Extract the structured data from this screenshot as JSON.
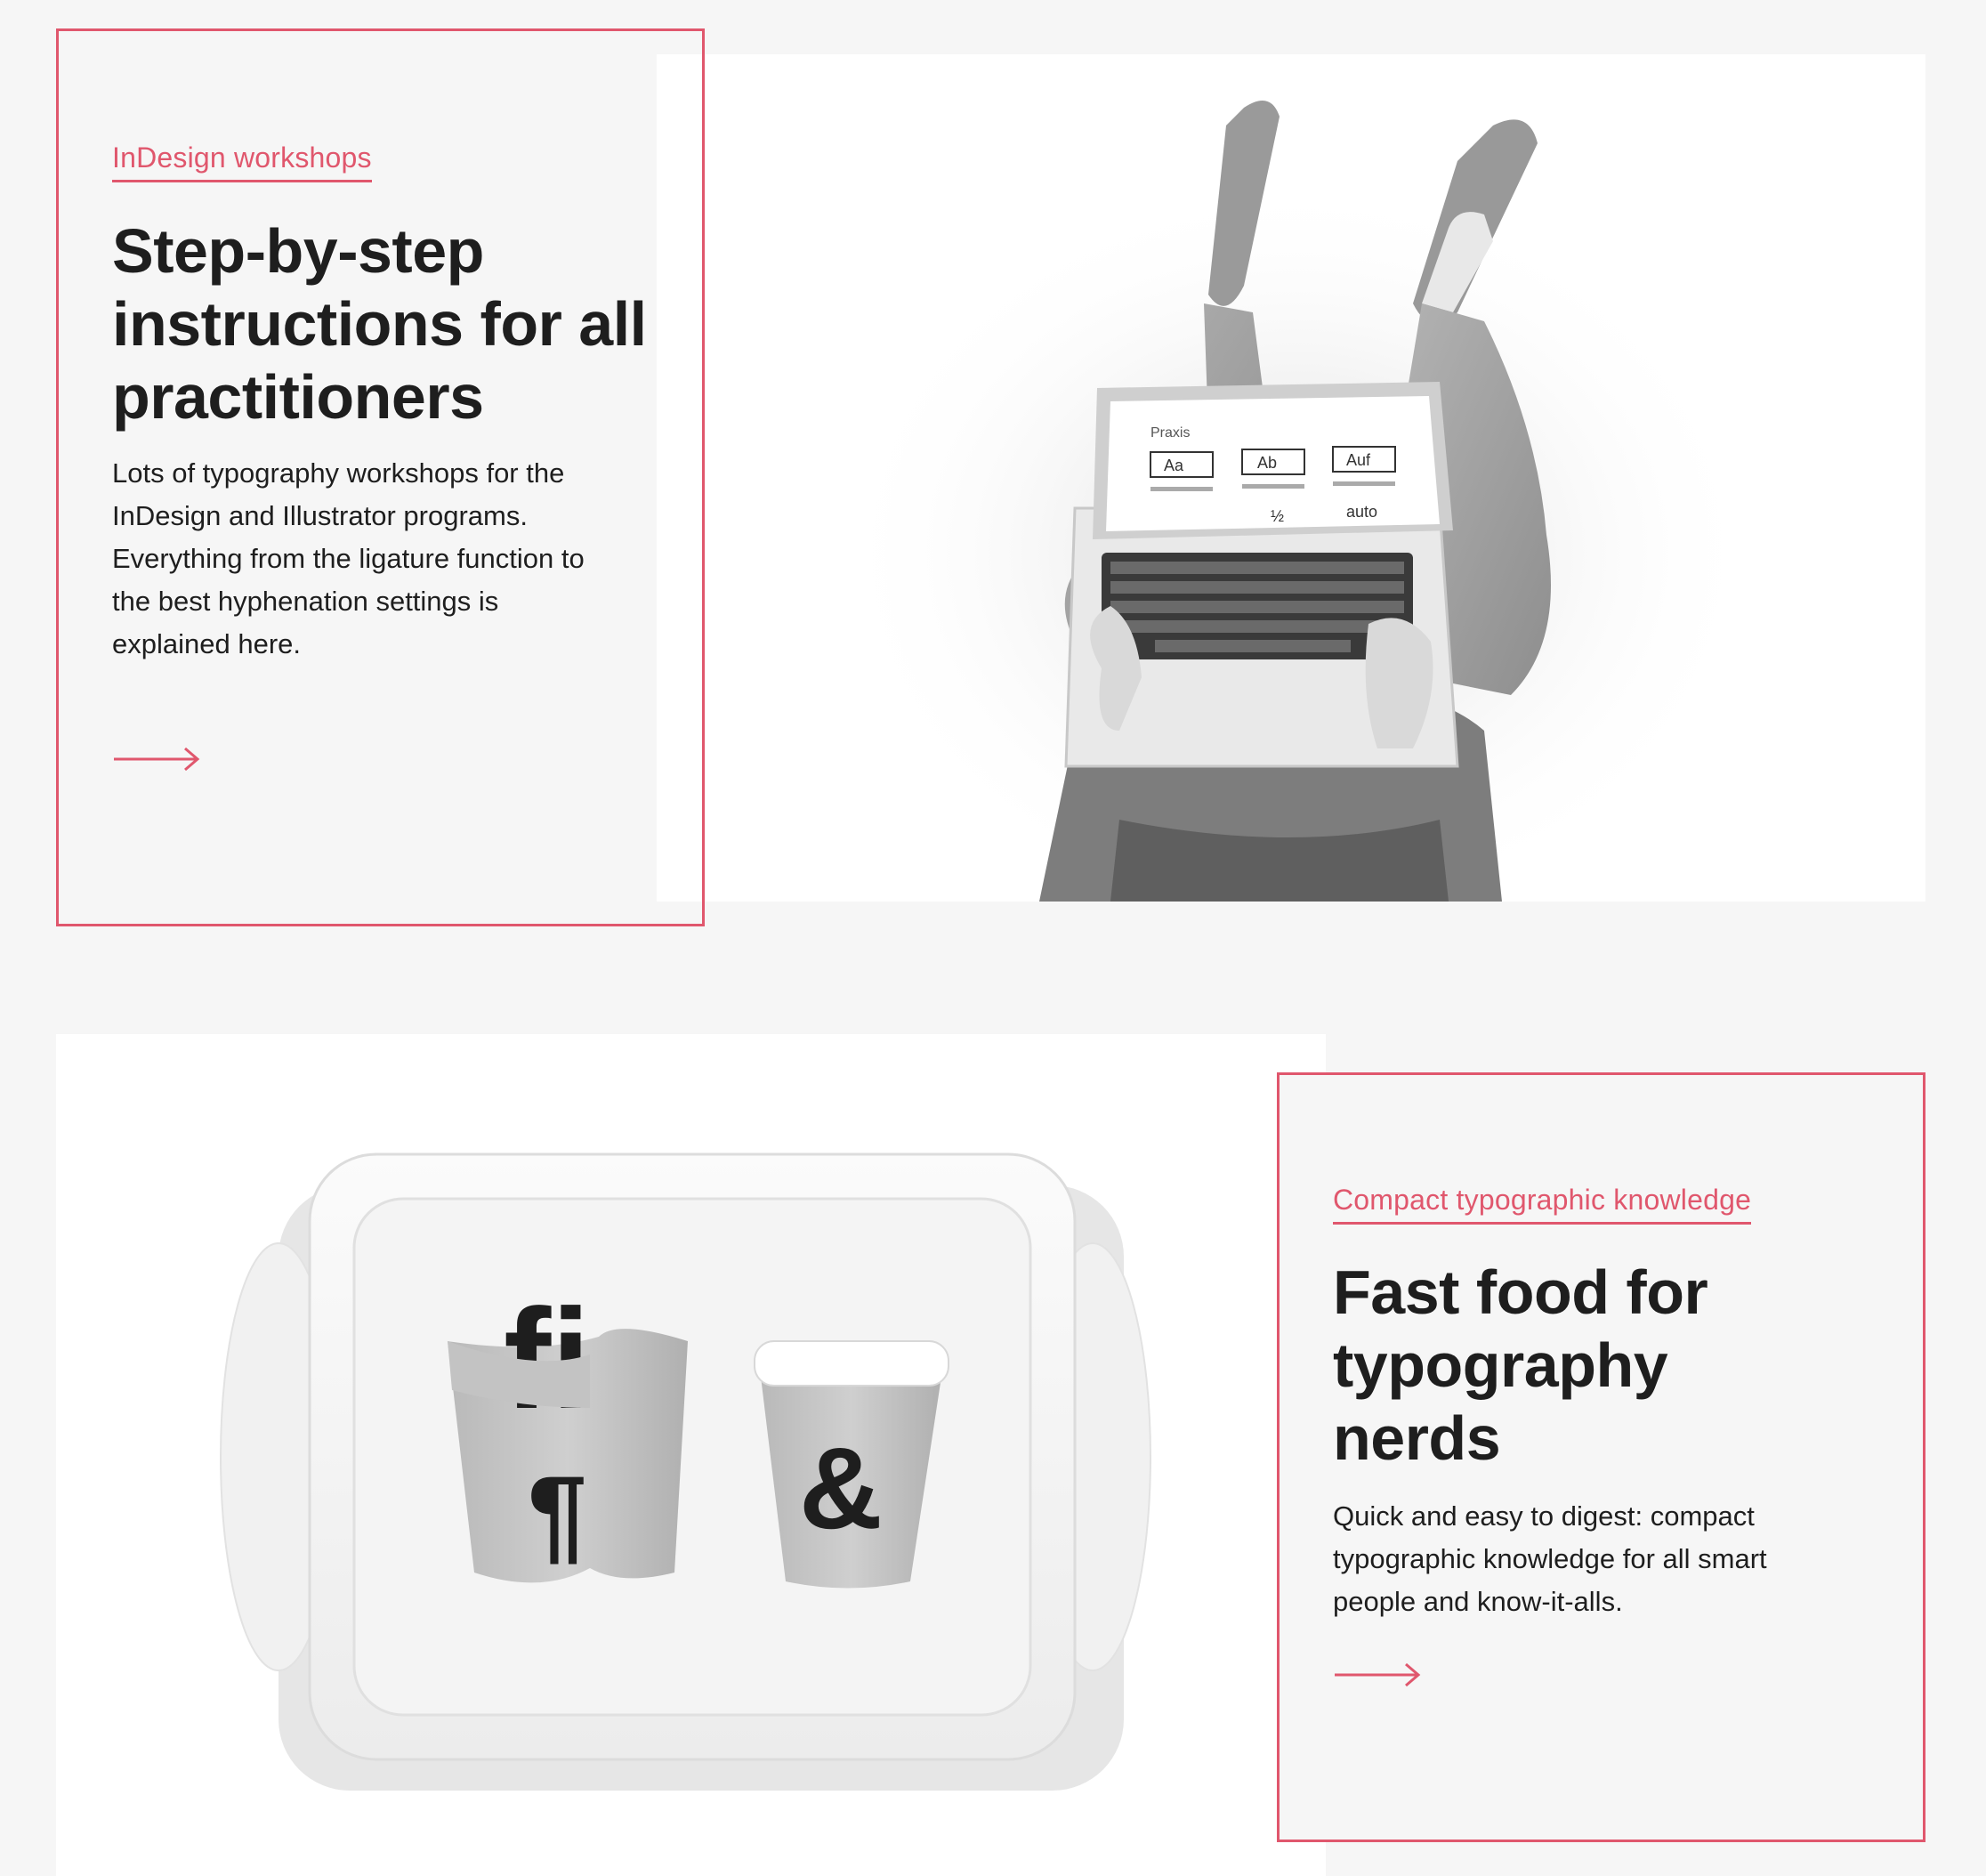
{
  "colors": {
    "accent": "#e0576d",
    "text": "#1e1e1e",
    "background": "#f6f6f6"
  },
  "section1": {
    "eyebrow": "InDesign workshops",
    "headline": "Step-by-step instructions for all practitioners",
    "body": "Lots of typography workshops for the InDesign and Illustrator programs. Everything from the ligature function to the best hyphenation settings is explained here.",
    "arrow_icon": "arrow-right-icon",
    "photo": {
      "screen_title": "Praxis",
      "tiles": [
        "Aa",
        "Ab",
        "Auf",
        "½",
        "auto"
      ]
    }
  },
  "section2": {
    "eyebrow": "Compact typographic knowledge",
    "headline": "Fast food for typography nerds",
    "body": "Quick and easy to digest: compact typographic knowledge for all smart people and know-it-alls.",
    "arrow_icon": "arrow-right-icon",
    "photo": {
      "fries_glyph": "fi",
      "fries_box_glyph": "¶",
      "cup_glyph": "&"
    }
  }
}
